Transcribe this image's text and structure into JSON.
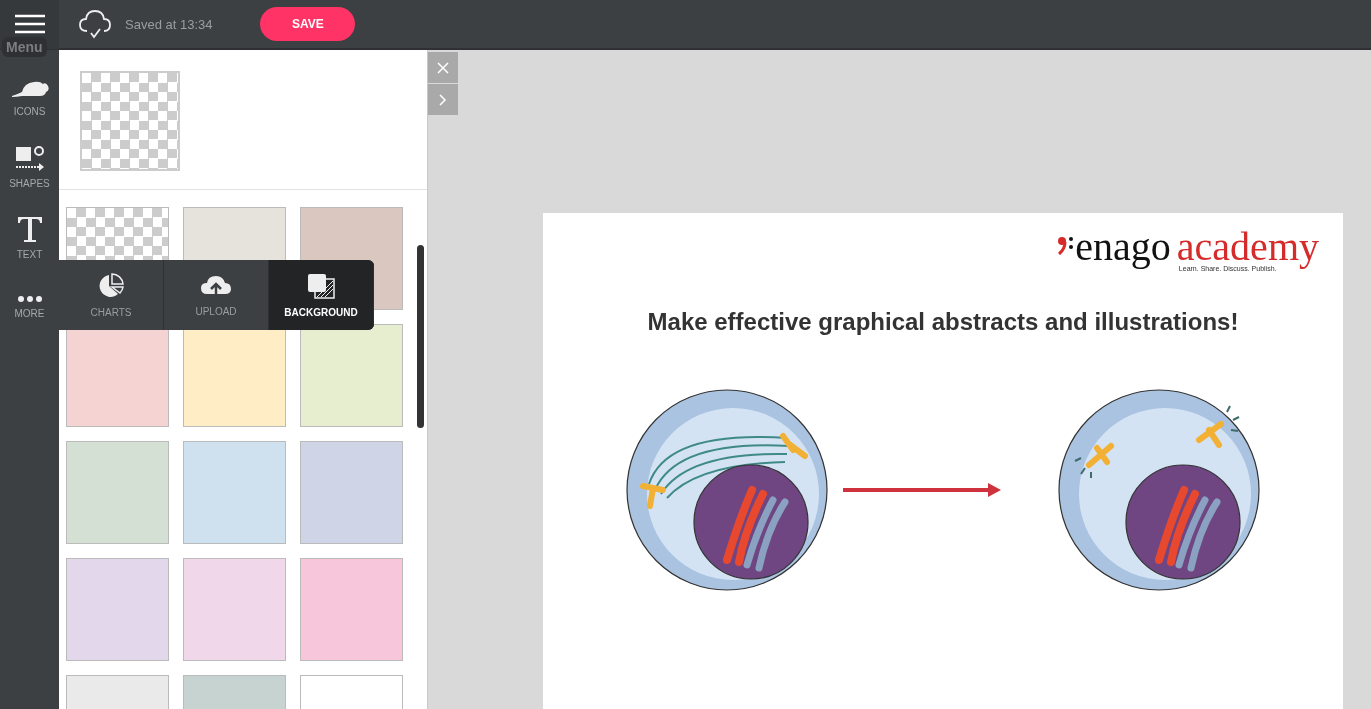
{
  "topbar": {
    "status": "Saved at 13:34",
    "save_button": "SAVE"
  },
  "rail": {
    "tooltip": "Menu",
    "items": [
      {
        "kind": "icons",
        "label": "ICONS"
      },
      {
        "kind": "shapes",
        "label": "SHAPES"
      },
      {
        "kind": "text",
        "label": "TEXT"
      },
      {
        "kind": "more",
        "label": "MORE"
      }
    ]
  },
  "popup": [
    {
      "kind": "charts",
      "label": "CHARTS",
      "selected": false
    },
    {
      "kind": "upload",
      "label": "UPLOAD",
      "selected": false
    },
    {
      "kind": "background",
      "label": "BACKGROUND",
      "selected": true
    }
  ],
  "swatches": [
    {
      "kind": "transparent"
    },
    {
      "kind": "solid",
      "color": "#e6e2dc"
    },
    {
      "kind": "solid",
      "color": "#dac8c0"
    },
    {
      "kind": "solid",
      "color": "#f5d3d3"
    },
    {
      "kind": "solid",
      "color": "#feedc5"
    },
    {
      "kind": "solid",
      "color": "#e7eed0"
    },
    {
      "kind": "solid",
      "color": "#d5e0d5"
    },
    {
      "kind": "solid",
      "color": "#cfe1ef"
    },
    {
      "kind": "solid",
      "color": "#cfd5e6"
    },
    {
      "kind": "solid",
      "color": "#e3d8eb"
    },
    {
      "kind": "solid",
      "color": "#f0d8ea"
    },
    {
      "kind": "solid",
      "color": "#f7c6da"
    },
    {
      "kind": "solid",
      "color": "#eaeaea"
    },
    {
      "kind": "solid",
      "color": "#c6d3d1"
    },
    {
      "kind": "solid",
      "color": "#ffffff"
    }
  ],
  "page": {
    "logo": {
      "brand": "enago",
      "product": "academy",
      "tagline": "Learn. Share. Discuss. Publish."
    },
    "title": "Make effective graphical abstracts and illustrations!"
  }
}
